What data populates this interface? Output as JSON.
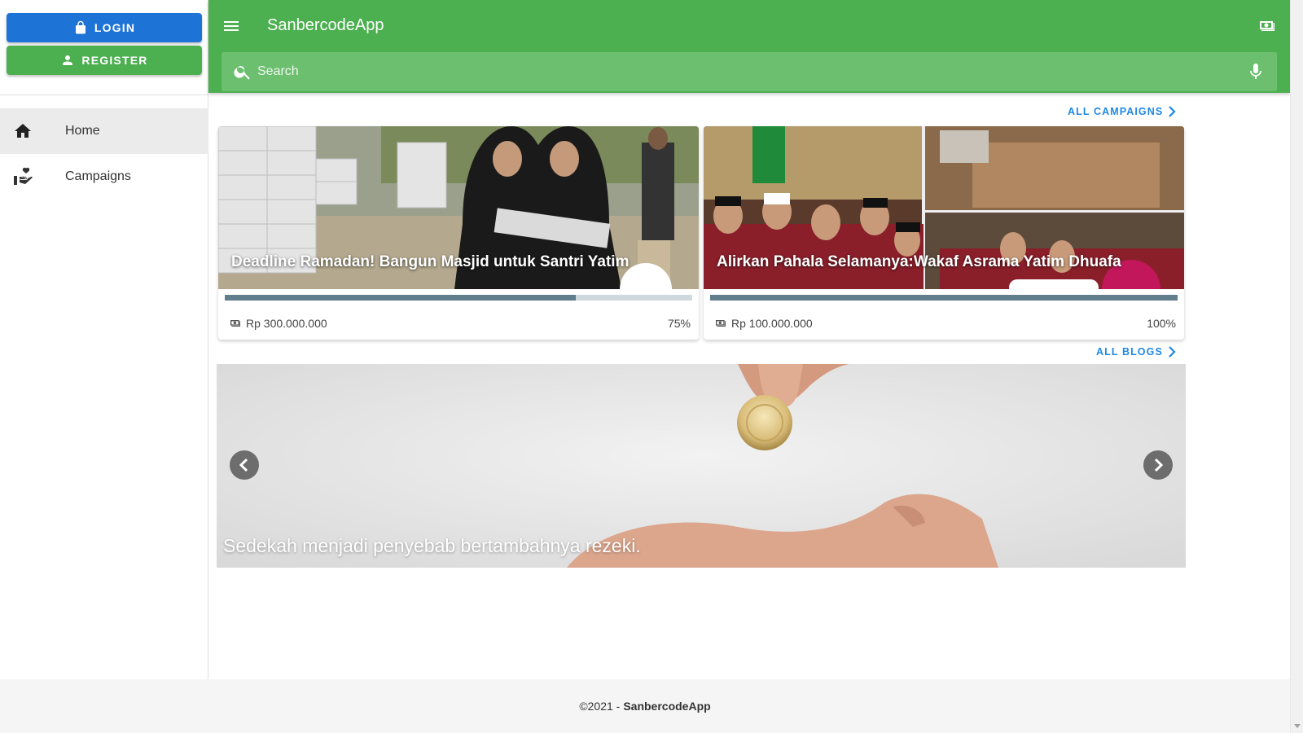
{
  "sidebar": {
    "login_label": "LOGIN",
    "register_label": "REGISTER",
    "items": [
      {
        "label": "Home",
        "icon": "home-icon"
      },
      {
        "label": "Campaigns",
        "icon": "hand-heart-icon"
      }
    ]
  },
  "appbar": {
    "title": "SanbercodeApp",
    "search_placeholder": "Search"
  },
  "campaigns": {
    "link_label": "ALL CAMPAIGNS",
    "items": [
      {
        "title": "Deadline Ramadan! Bangun Masjid untuk Santri Yatim",
        "amount": "Rp 300.000.000",
        "percent_label": "75%",
        "progress": 0.75
      },
      {
        "title": "Alirkan Pahala Selamanya:Wakaf Asrama Yatim Dhuafa",
        "amount": "Rp 100.000.000",
        "percent_label": "100%",
        "progress": 1.0
      }
    ]
  },
  "blogs": {
    "link_label": "ALL BLOGS",
    "caption": "Sedekah menjadi penyebab bertambahnya rezeki."
  },
  "footer": {
    "copyright": "©2021 -",
    "brand": "SanbercodeApp"
  },
  "colors": {
    "primary_green": "#4caf50",
    "login_blue": "#1e74d6",
    "link_blue": "#1e88e5",
    "progress": "#607d8b"
  }
}
